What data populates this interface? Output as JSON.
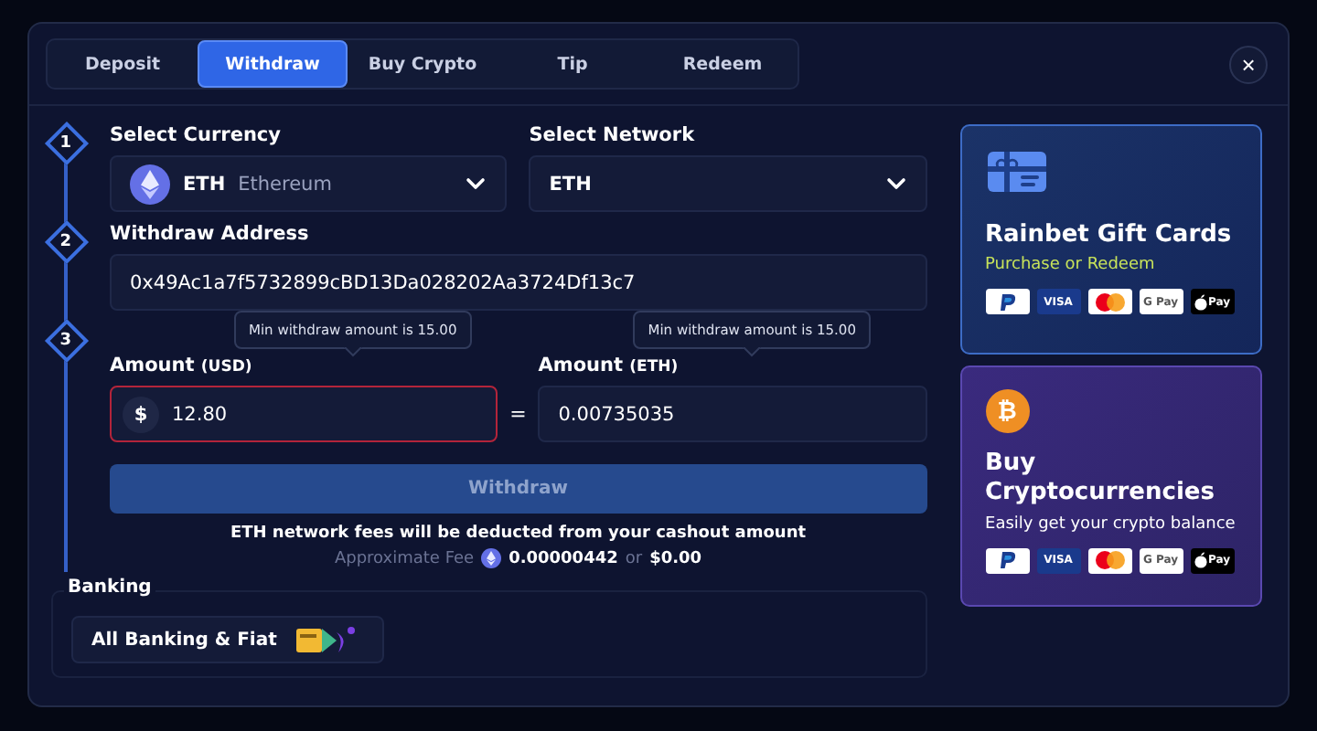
{
  "tabs": [
    {
      "label": "Deposit",
      "selected": false
    },
    {
      "label": "Withdraw",
      "selected": true
    },
    {
      "label": "Buy Crypto",
      "selected": false
    },
    {
      "label": "Tip",
      "selected": false
    },
    {
      "label": "Redeem",
      "selected": false
    }
  ],
  "close_button": "×",
  "steps": [
    {
      "number": "1"
    },
    {
      "number": "2"
    },
    {
      "number": "3"
    }
  ],
  "currency": {
    "label": "Select Currency",
    "code": "ETH",
    "name": "Ethereum"
  },
  "network": {
    "label": "Select Network",
    "value": "ETH"
  },
  "address": {
    "label": "Withdraw Address",
    "value": "0x49Ac1a7f5732899cBD13Da028202Aa3724Df13c7"
  },
  "amount_usd": {
    "label": "Amount",
    "unit": "(USD)",
    "symbol": "$",
    "value": "12.80",
    "error": true,
    "tooltip": "Min withdraw amount is 15.00"
  },
  "equals": "=",
  "amount_eth": {
    "label": "Amount",
    "unit": "(ETH)",
    "value": "0.00735035",
    "error": false,
    "tooltip": "Min withdraw amount is 15.00"
  },
  "withdraw_button": {
    "label": "Withdraw",
    "disabled": true
  },
  "fee_notice": "ETH network fees will be deducted from your cashout amount",
  "fee": {
    "label": "Approximate Fee",
    "eth": "0.00000442",
    "or": "or",
    "usd": "$0.00"
  },
  "banking": {
    "label": "Banking",
    "option": "All Banking & Fiat"
  },
  "promo_cards": [
    {
      "kind": "gift",
      "title": "Rainbet Gift Cards",
      "subtitle": "Purchase or Redeem",
      "payment_methods": [
        {
          "kind": "paypal"
        },
        {
          "kind": "visa",
          "label": "VISA"
        },
        {
          "kind": "mastercard"
        },
        {
          "kind": "gpay",
          "label": "G Pay"
        },
        {
          "kind": "applepay",
          "label": "Pay"
        }
      ]
    },
    {
      "kind": "crypto",
      "title": "Buy Cryptocurrencies",
      "subtitle": "Easily get your crypto balance",
      "glyph": "₿",
      "payment_methods": [
        {
          "kind": "paypal"
        },
        {
          "kind": "visa",
          "label": "VISA"
        },
        {
          "kind": "mastercard"
        },
        {
          "kind": "gpay",
          "label": "G Pay"
        },
        {
          "kind": "applepay",
          "label": "Pay"
        }
      ]
    }
  ]
}
